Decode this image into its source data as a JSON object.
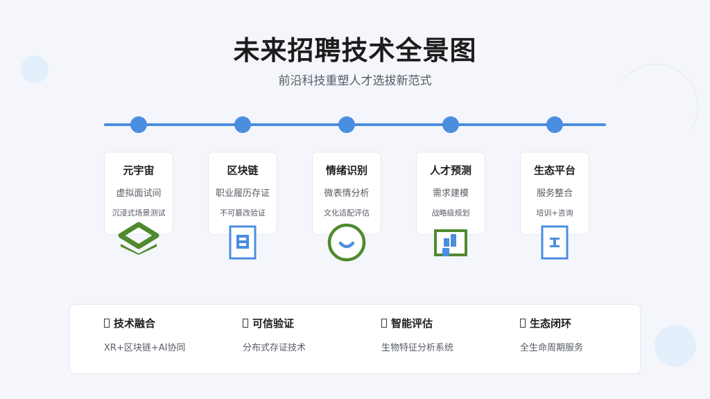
{
  "header": {
    "title": "未来招聘技术全景图",
    "subtitle": "前沿科技重塑人才选拔新范式"
  },
  "colors": {
    "accent_blue": "#4a8ee0",
    "accent_green": "#4f8a2e",
    "background": "#f4f6fb"
  },
  "stages": [
    {
      "title": "元宇宙",
      "subtitle": "虚拟面试间",
      "detail": "沉浸式场景测试",
      "icon": "layers-icon"
    },
    {
      "title": "区块链",
      "subtitle": "职业履历存证",
      "detail": "不可篡改验证",
      "icon": "document-icon"
    },
    {
      "title": "情绪识别",
      "subtitle": "微表情分析",
      "detail": "文化适配评估",
      "icon": "smile-icon"
    },
    {
      "title": "人才预测",
      "subtitle": "需求建模",
      "detail": "战略级规划",
      "icon": "chart-icon"
    },
    {
      "title": "生态平台",
      "subtitle": "服务整合",
      "detail": "培训+咨询",
      "icon": "file-icon"
    }
  ],
  "features": [
    {
      "title": "技术融合",
      "desc": "XR+区块链+AI协同"
    },
    {
      "title": "可信验证",
      "desc": "分布式存证技术"
    },
    {
      "title": "智能评估",
      "desc": "生物特征分析系统"
    },
    {
      "title": "生态闭环",
      "desc": "全生命周期服务"
    }
  ]
}
